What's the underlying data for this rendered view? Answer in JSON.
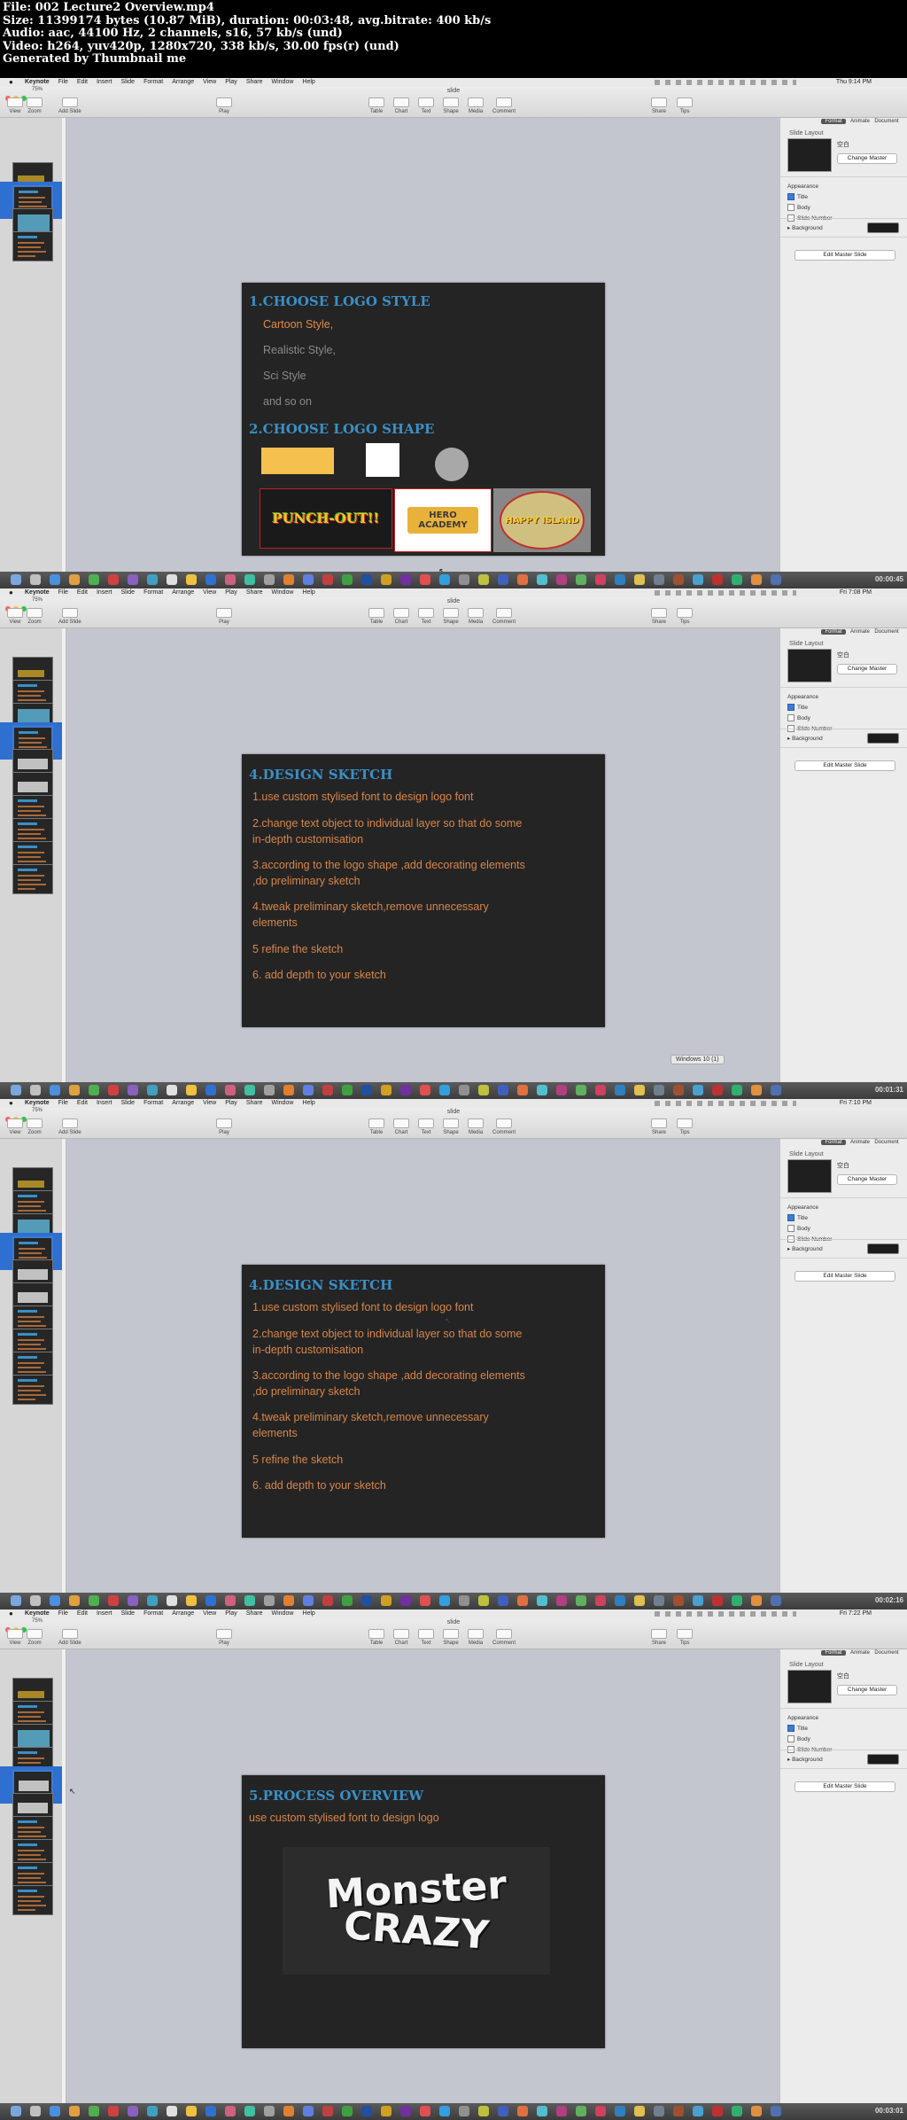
{
  "header": {
    "lines": [
      "File: 002 Lecture2 Overview.mp4",
      "Size: 11399174 bytes (10.87 MiB), duration: 00:03:48, avg.bitrate: 400 kb/s",
      "Audio: aac, 44100 Hz, 2 channels, s16, 57 kb/s (und)",
      "Video: h264, yuv420p, 1280x720, 338 kb/s, 30.00 fps(r) (und)",
      "Generated by Thumbnail me"
    ]
  },
  "app": {
    "apple": "",
    "menus": [
      "Keynote",
      "File",
      "Edit",
      "Insert",
      "Slide",
      "Format",
      "Arrange",
      "View",
      "Play",
      "Share",
      "Window",
      "Help"
    ],
    "doc_title": "slide",
    "toolbar": {
      "view": "View",
      "zoom": "Zoom",
      "zoom_value": "75%",
      "add_slide": "Add Slide",
      "play": "Play",
      "table": "Table",
      "chart": "Chart",
      "text": "Text",
      "shape": "Shape",
      "media": "Media",
      "comment": "Comment",
      "share": "Share",
      "tips": "Tips"
    },
    "inspector": {
      "tabs": [
        "Format",
        "Animate",
        "Document"
      ],
      "label": "Slide Layout",
      "master_name": "空白",
      "change_master": "Change Master",
      "appearance": "Appearance",
      "title_opt": "Title",
      "body_opt": "Body",
      "slide_number_opt": "Slide Number",
      "background": "Background",
      "edit_master": "Edit Master Slide",
      "background_color": "#1b1b1b"
    }
  },
  "frames": [
    {
      "clock": "Thu 9:14 PM",
      "timestamp": "00:00:45",
      "slide": {
        "heading1": "1.CHOOSE LOGO STYLE",
        "styles": [
          "Cartoon Style,",
          "Realistic Style,",
          "Sci Style",
          "and so on"
        ],
        "heading2": "2.CHOOSE LOGO SHAPE",
        "logos": [
          "PUNCH-OUT!!",
          "HERO ACADEMY",
          "HAPPY ISLAND"
        ]
      }
    },
    {
      "clock": "Fri 7:08 PM",
      "timestamp": "00:01:31",
      "tooltip": "Windows 10 (1)",
      "slide": {
        "heading": "4.DESIGN SKETCH",
        "items": [
          "1.use custom stylised font to design logo font",
          "2.change text object to individual layer so that do some in-depth customisation",
          "3.according to the logo shape ,add decorating elements ,do preliminary sketch",
          "4.tweak preliminary sketch,remove unnecessary elements",
          "5 refine the sketch",
          "6. add depth to your sketch"
        ]
      }
    },
    {
      "clock": "Fri 7:10 PM",
      "timestamp": "00:02:16",
      "slide": {
        "heading": "4.DESIGN SKETCH",
        "items": [
          "1.use custom stylised font to design logo font",
          "2.change text object to individual layer so that do some in-depth customisation",
          "3.according to the logo shape ,add decorating elements ,do preliminary sketch",
          "4.tweak preliminary sketch,remove unnecessary elements",
          "5 refine the sketch",
          "6. add depth to your sketch"
        ]
      }
    },
    {
      "clock": "Fri 7:22 PM",
      "timestamp": "00:03:01",
      "slide": {
        "heading": "5.PROCESS OVERVIEW",
        "subtitle": "use custom stylised font to design logo",
        "logo_line1": "Monster",
        "logo_line2": "CRAZY"
      }
    }
  ]
}
